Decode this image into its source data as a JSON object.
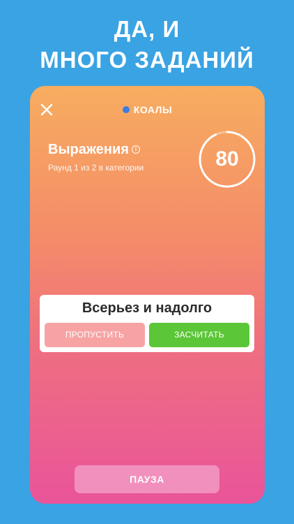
{
  "headline": {
    "line1": "ДА, И",
    "line2": "МНОГО ЗАДАНИЙ"
  },
  "game": {
    "team_name": "КОАЛЫ",
    "team_color": "#3b7de0",
    "category": "Выражения",
    "round_info": "Раунд 1 из 2 в категории",
    "timer_value": "80",
    "timer_remaining_fraction": 0.93,
    "word": "Всерьез и надолго",
    "skip_label": "ПРОПУСТИТЬ",
    "accept_label": "ЗАСЧИТАТЬ",
    "pause_label": "ПАУЗА"
  },
  "colors": {
    "background": "#3aa3e3",
    "accept": "#5bc637",
    "skip": "#f7a3a4",
    "pause": "#f190bd"
  },
  "icons": {
    "close": "close-icon",
    "info": "info-icon"
  }
}
